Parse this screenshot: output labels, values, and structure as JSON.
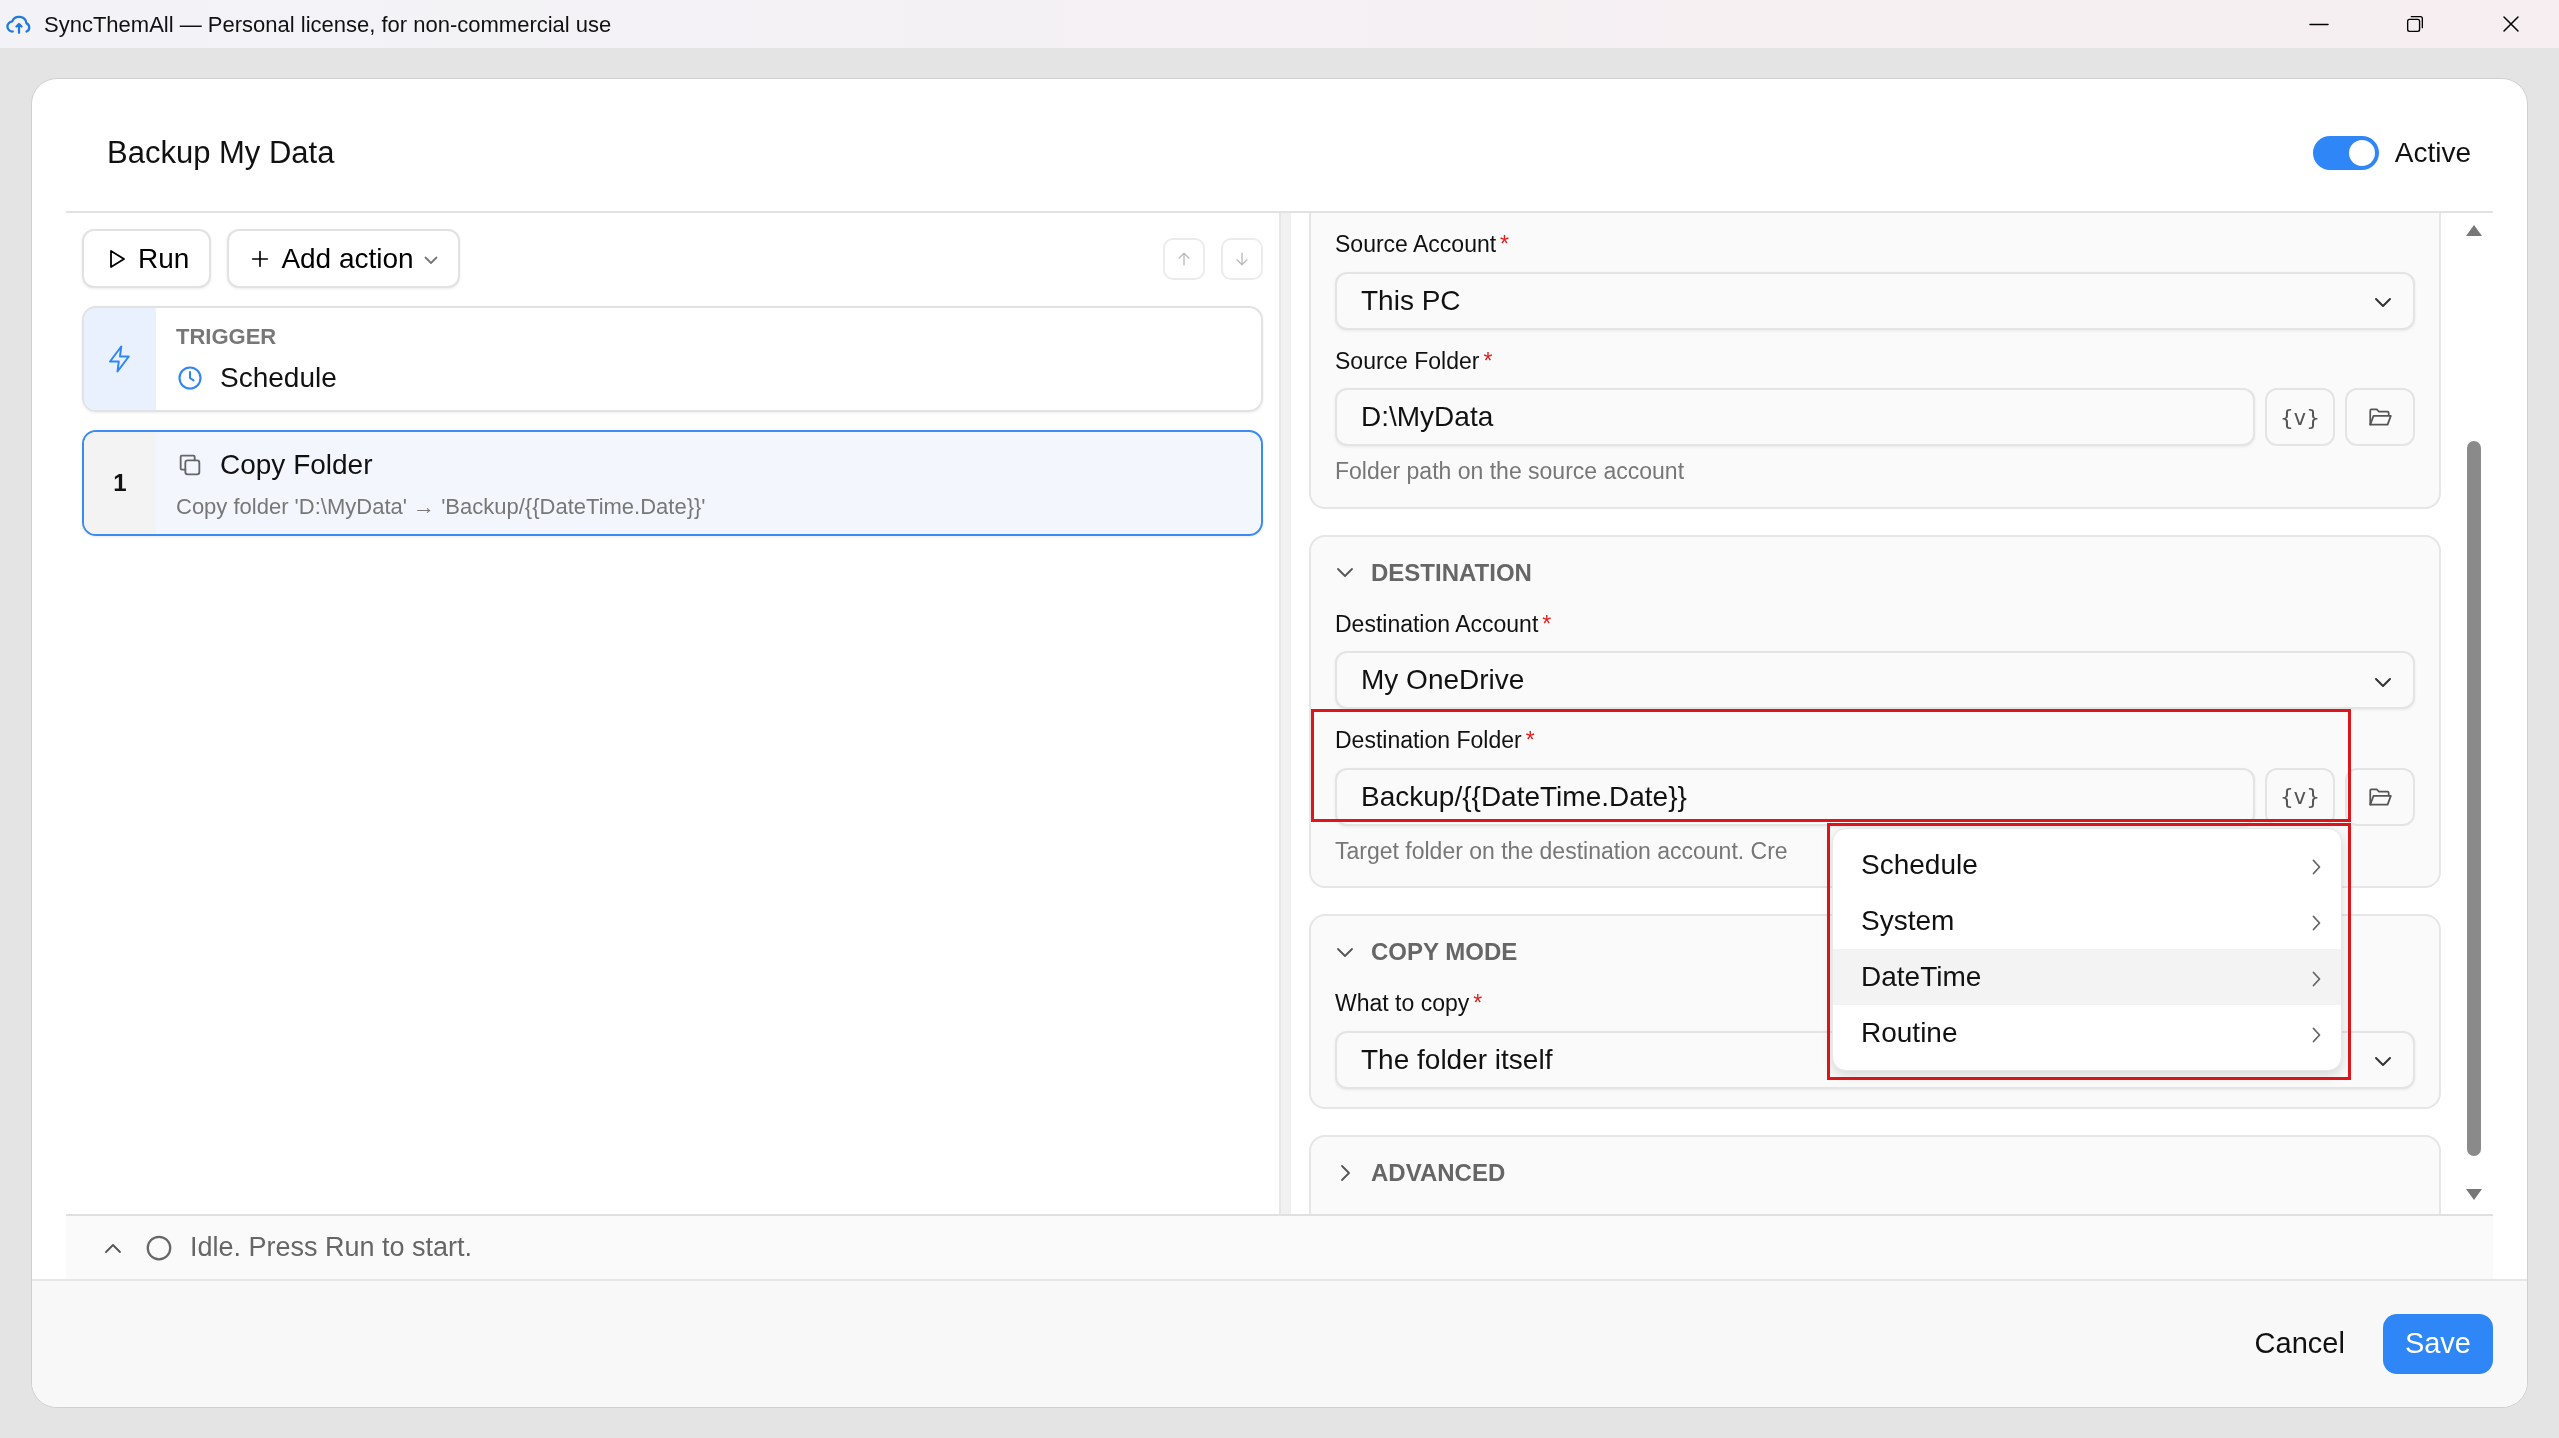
{
  "window": {
    "title": "SyncThemAll — Personal license, for non-commercial use"
  },
  "dialog": {
    "title": "Backup My Data",
    "active": {
      "label": "Active",
      "on": true
    }
  },
  "toolbar": {
    "run": "Run",
    "add_action": "Add action"
  },
  "trigger": {
    "heading": "TRIGGER",
    "name": "Schedule"
  },
  "actions": [
    {
      "number": "1",
      "title": "Copy Folder",
      "description": "Copy folder 'D:\\MyData' → 'Backup/{{DateTime.Date}}'",
      "selected": true
    }
  ],
  "sections": [
    {
      "fields": [
        {
          "kind": "select",
          "label": "Source Account",
          "required_mark": "*",
          "value": "This PC"
        },
        {
          "kind": "path",
          "label": "Source Folder",
          "required_mark": "*",
          "value": "D:\\MyData",
          "variable_button": "{v}",
          "helper": "Folder path on the source account"
        }
      ]
    },
    {
      "title": "DESTINATION",
      "expanded": true,
      "fields": [
        {
          "kind": "select",
          "label": "Destination Account",
          "required_mark": "*",
          "value": "My OneDrive"
        },
        {
          "kind": "path",
          "label": "Destination Folder",
          "required_mark": "*",
          "value": "Backup/{{DateTime.Date}}",
          "variable_button": "{v}",
          "helper": "Target folder on the destination account. Cre",
          "highlighted": true,
          "variable_menu": {
            "highlighted": true,
            "items": [
              {
                "label": "Schedule",
                "selected": false
              },
              {
                "label": "System",
                "selected": false
              },
              {
                "label": "DateTime",
                "selected": true
              },
              {
                "label": "Routine",
                "selected": false
              }
            ]
          }
        }
      ]
    },
    {
      "title": "COPY MODE",
      "expanded": true,
      "fields": [
        {
          "kind": "select",
          "label": "What to copy",
          "required_mark": "*",
          "value": "The folder itself"
        }
      ]
    },
    {
      "title": "ADVANCED",
      "expanded": false
    }
  ],
  "status": {
    "text": "Idle. Press Run to start."
  },
  "footer": {
    "cancel": "Cancel",
    "save": "Save"
  }
}
